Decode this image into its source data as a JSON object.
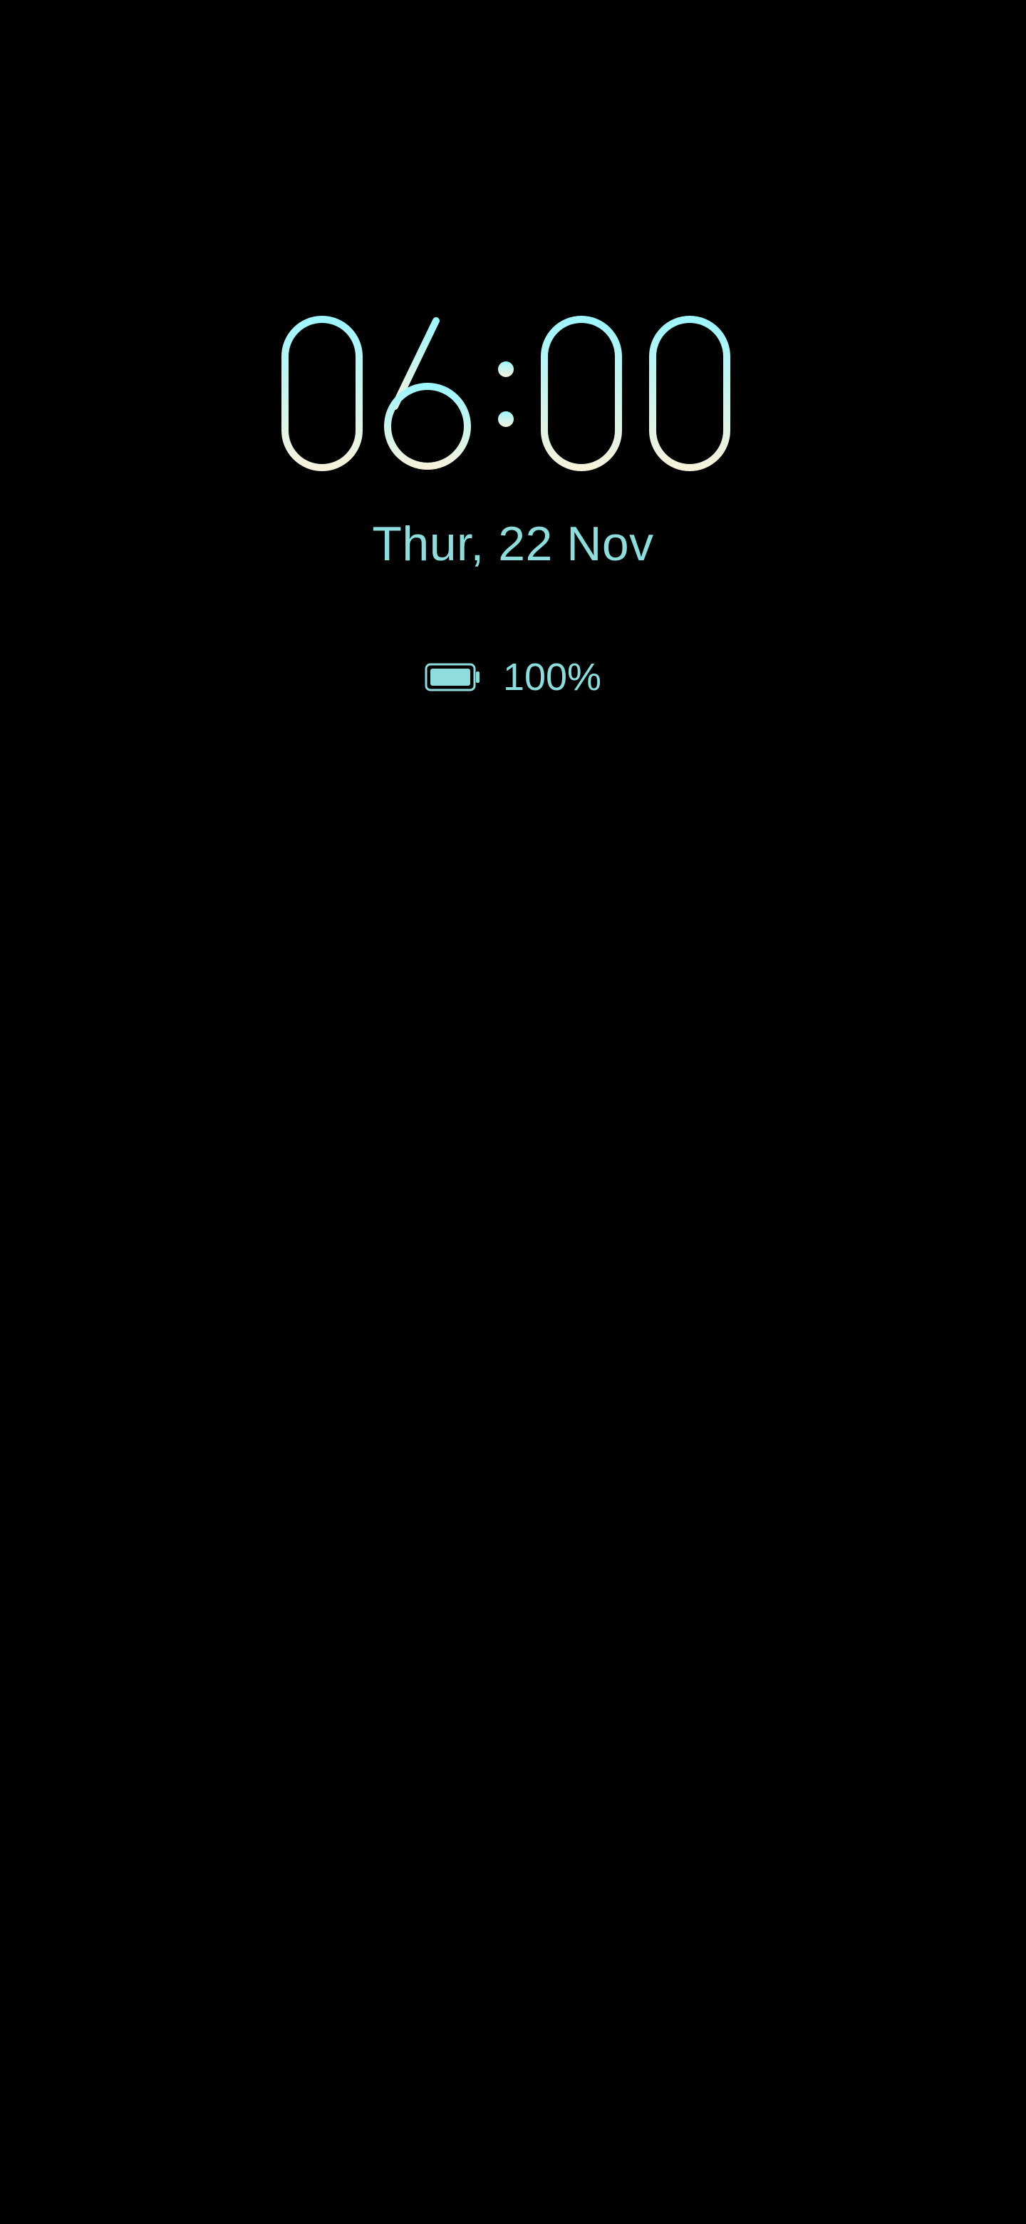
{
  "screen": {
    "type": "always-on-display",
    "background": "#000000"
  },
  "clock": {
    "time": "06:00",
    "gradient": [
      "#9ff6ff",
      "#f6f2dc",
      "#9ff6ff"
    ]
  },
  "date": {
    "label": "Thur, 22 Nov",
    "color": "#8fdcdc"
  },
  "battery": {
    "icon": "battery-full-icon",
    "level_percent": 100,
    "label": "100%",
    "color": "#8fdcdc"
  }
}
